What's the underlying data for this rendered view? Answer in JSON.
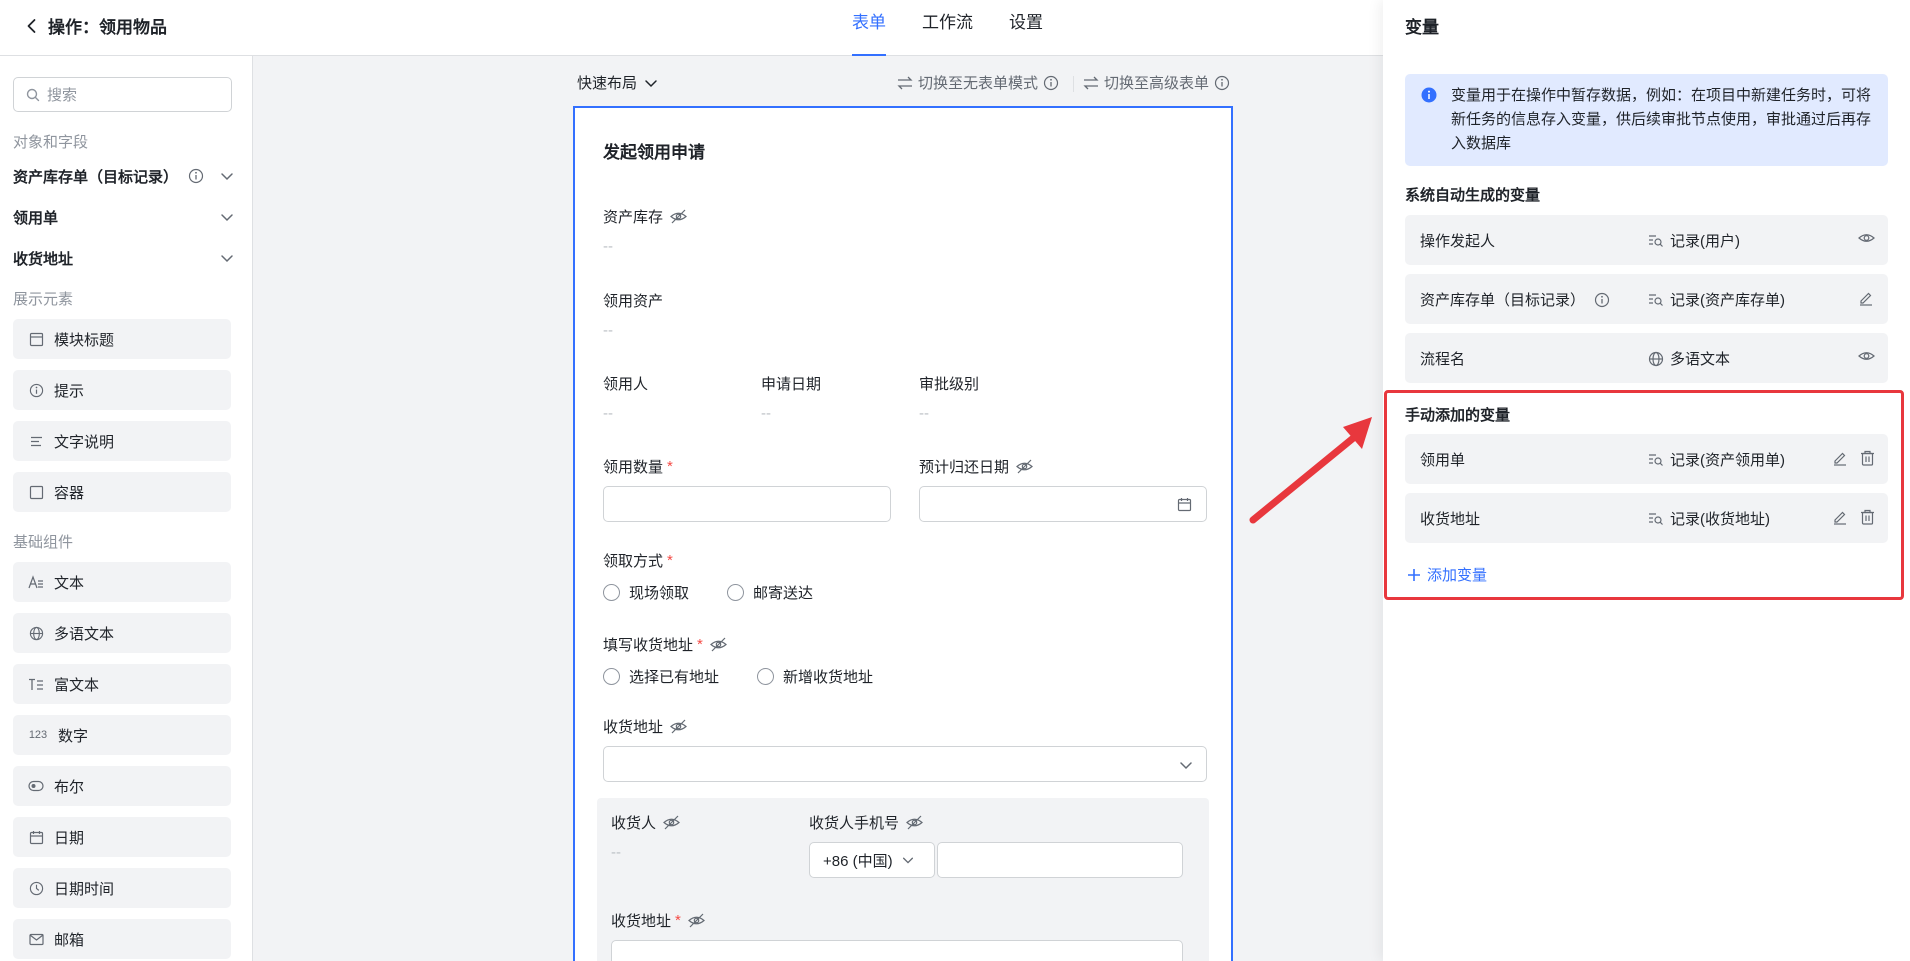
{
  "header": {
    "back_icon": "chevron-left-icon",
    "title": "操作：领用物品",
    "tabs": [
      {
        "label": "表单",
        "active": true
      },
      {
        "label": "工作流",
        "active": false
      },
      {
        "label": "设置",
        "active": false
      }
    ]
  },
  "sidebar": {
    "search_placeholder": "搜索",
    "objects_heading": "对象和字段",
    "objects": [
      {
        "label": "资产库存单（目标记录）",
        "has_info": true
      },
      {
        "label": "领用单"
      },
      {
        "label": "收货地址"
      }
    ],
    "display_heading": "展示元素",
    "display_items": [
      {
        "label": "模块标题",
        "icon": "module-title-icon"
      },
      {
        "label": "提示",
        "icon": "info-icon"
      },
      {
        "label": "文字说明",
        "icon": "text-lines-icon"
      },
      {
        "label": "容器",
        "icon": "container-icon"
      }
    ],
    "basic_heading": "基础组件",
    "basic_items": [
      {
        "label": "文本",
        "icon": "text-icon"
      },
      {
        "label": "多语文本",
        "icon": "globe-icon"
      },
      {
        "label": "富文本",
        "icon": "rich-text-icon"
      },
      {
        "label": "数字",
        "icon": "number-icon",
        "glyph": "123"
      },
      {
        "label": "布尔",
        "icon": "toggle-icon"
      },
      {
        "label": "日期",
        "icon": "calendar-icon"
      },
      {
        "label": "日期时间",
        "icon": "clock-icon"
      },
      {
        "label": "邮箱",
        "icon": "mail-icon"
      }
    ]
  },
  "canvas": {
    "quick_layout": "快速布局",
    "switch_no_form": "切换至无表单模式",
    "switch_advanced": "切换至高级表单",
    "form": {
      "title": "发起领用申请",
      "asset_inventory": {
        "label": "资产库存",
        "value": "--"
      },
      "asset": {
        "label": "领用资产",
        "value": "--"
      },
      "requester": {
        "label": "领用人",
        "value": "--"
      },
      "apply_date": {
        "label": "申请日期",
        "value": "--"
      },
      "approval_level": {
        "label": "审批级别",
        "value": "--"
      },
      "quantity": {
        "label": "领用数量",
        "required_mark": "*"
      },
      "return_date": {
        "label": "预计归还日期"
      },
      "pickup_method": {
        "label": "领取方式",
        "required_mark": "*",
        "options": [
          "现场领取",
          "邮寄送达"
        ]
      },
      "fill_address": {
        "label": "填写收货地址",
        "required_mark": "*",
        "options": [
          "选择已有地址",
          "新增收货地址"
        ]
      },
      "shipping_address": {
        "label": "收货地址"
      },
      "receiver": {
        "label": "收货人",
        "value": "--"
      },
      "receiver_phone": {
        "label": "收货人手机号",
        "country_code": "+86 (中国)"
      },
      "receiver_address": {
        "label": "收货地址",
        "required_mark": "*"
      }
    }
  },
  "panel": {
    "title": "变量",
    "notice": "变量用于在操作中暂存数据，例如：在项目中新建任务时，可将新任务的信息存入变量，供后续审批节点使用，审批通过后再存入数据库",
    "auto_heading": "系统自动生成的变量",
    "auto_vars": [
      {
        "name": "操作发起人",
        "type": "记录(用户)",
        "type_icon": "record-search-icon",
        "action_icon": "eye-icon"
      },
      {
        "name": "资产库存单（目标记录）",
        "type": "记录(资产库存单)",
        "type_icon": "record-search-icon",
        "action_icon": "edit-icon",
        "has_info": true
      },
      {
        "name": "流程名",
        "type": "多语文本",
        "type_icon": "globe-icon",
        "action_icon": "eye-icon"
      }
    ],
    "manual_heading": "手动添加的变量",
    "manual_vars": [
      {
        "name": "领用单",
        "type": "记录(资产领用单)",
        "type_icon": "record-search-icon"
      },
      {
        "name": "收货地址",
        "type": "记录(收货地址)",
        "type_icon": "record-search-icon"
      }
    ],
    "add_variable": "添加变量"
  },
  "colors": {
    "accent": "#3370ff",
    "annotation_red": "#e8373d",
    "notice_bg": "#e1eaff"
  }
}
